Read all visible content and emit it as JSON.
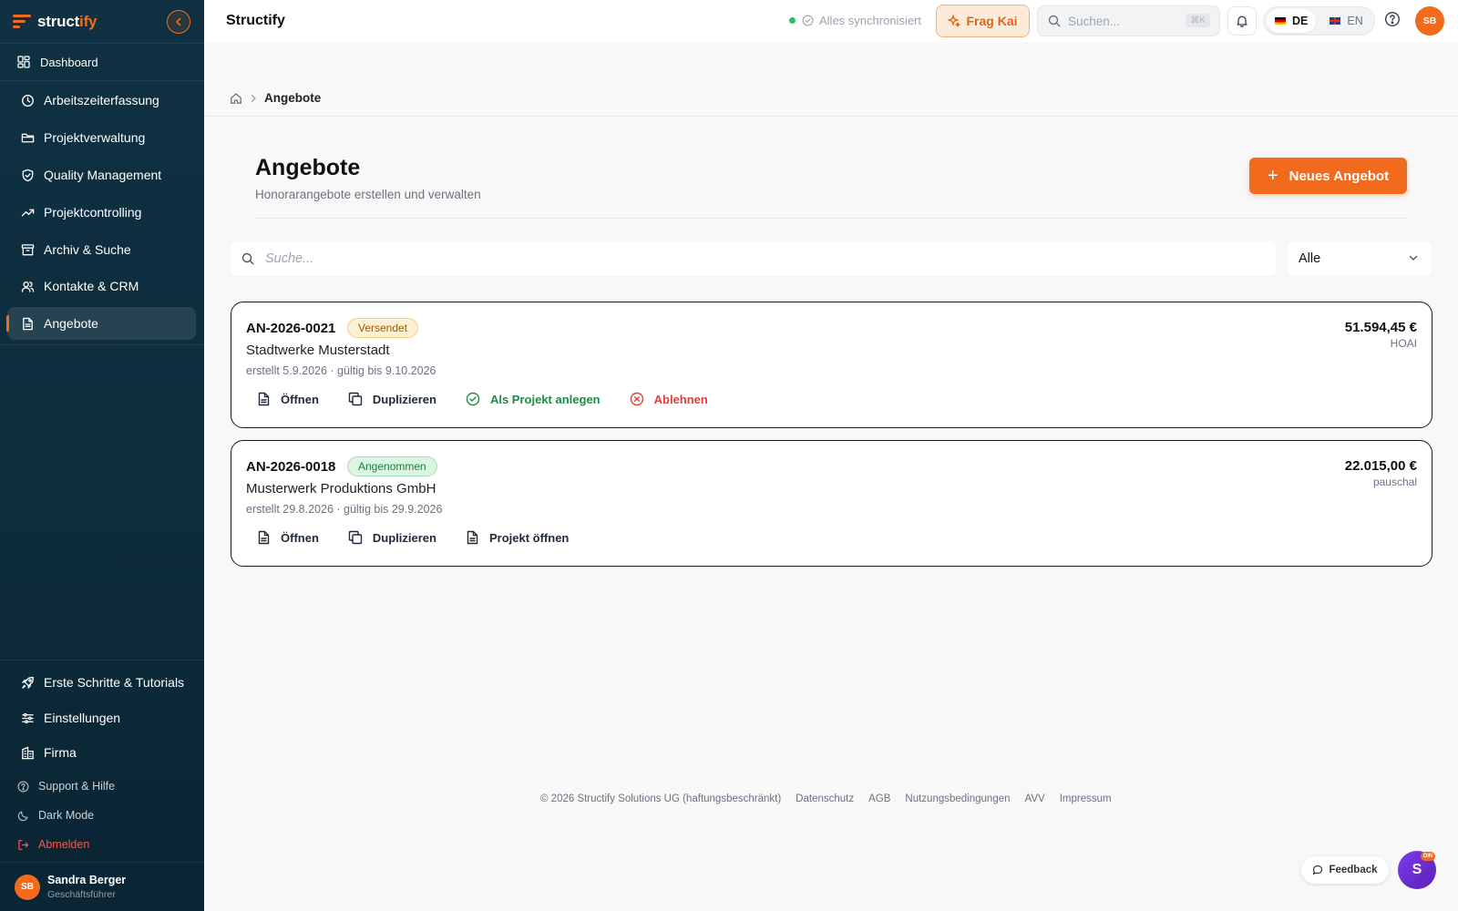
{
  "brand": {
    "name_part1": "struct",
    "name_part2": "ify",
    "accent": "#f26b1d",
    "sidebar_bg": "#0f3142"
  },
  "sidebar": {
    "dashboard": "Dashboard",
    "items": [
      {
        "label": "Arbeitszeiterfassung",
        "icon": "clock-icon"
      },
      {
        "label": "Projektverwaltung",
        "icon": "folder-icon"
      },
      {
        "label": "Quality Management",
        "icon": "shield-check-icon"
      },
      {
        "label": "Projektcontrolling",
        "icon": "trending-up-icon"
      },
      {
        "label": "Archiv & Suche",
        "icon": "archive-icon"
      },
      {
        "label": "Kontakte & CRM",
        "icon": "users-icon"
      },
      {
        "label": "Angebote",
        "icon": "document-icon",
        "active": true
      }
    ],
    "bottom_items": [
      {
        "label": "Erste Schritte & Tutorials",
        "icon": "rocket-icon"
      },
      {
        "label": "Einstellungen",
        "icon": "sliders-icon"
      },
      {
        "label": "Firma",
        "icon": "building-icon"
      }
    ],
    "small_items": [
      {
        "label": "Support & Hilfe",
        "icon": "help-circle-icon"
      },
      {
        "label": "Dark Mode",
        "icon": "moon-icon"
      },
      {
        "label": "Abmelden",
        "icon": "logout-icon"
      }
    ],
    "user": {
      "initials": "SB",
      "name": "Sandra Berger",
      "role": "Geschäftsführer"
    }
  },
  "topbar": {
    "title": "Structify",
    "sync_text": "Alles synchronisiert",
    "kai_label": "Frag Kai",
    "search_placeholder": "Suchen...",
    "search_shortcut": "⌘K",
    "lang_de": "DE",
    "lang_en": "EN",
    "avatar_initials": "SB"
  },
  "breadcrumb": {
    "current": "Angebote"
  },
  "page": {
    "title": "Angebote",
    "subtitle": "Honorarangebote erstellen und verwalten",
    "new_button": "Neues Angebot",
    "search_placeholder": "Suche...",
    "filter_value": "Alle"
  },
  "offers": [
    {
      "id": "AN-2026-0021",
      "status": "Versendet",
      "client": "Stadtwerke Musterstadt",
      "dates": "erstellt 5.9.2026 · gültig bis 9.10.2026",
      "amount": "51.594,45 €",
      "type": "HOAI",
      "actions": [
        "Öffnen",
        "Duplizieren",
        "Als Projekt anlegen",
        "Ablehnen"
      ]
    },
    {
      "id": "AN-2026-0018",
      "status": "Angenommen",
      "client": "Musterwerk Produktions GmbH",
      "dates": "erstellt 29.8.2026 · gültig bis 29.9.2026",
      "amount": "22.015,00 €",
      "type": "pauschal",
      "actions": [
        "Öffnen",
        "Duplizieren",
        "Projekt öffnen"
      ]
    }
  ],
  "footer": {
    "copyright": "© 2026 Structify Solutions UG (haftungsbeschränkt)",
    "links": [
      "Datenschutz",
      "AGB",
      "Nutzungsbedingungen",
      "AVV",
      "Impressum"
    ]
  },
  "feedback_label": "Feedback",
  "chat": {
    "letter": "S",
    "badge": "DIN"
  }
}
